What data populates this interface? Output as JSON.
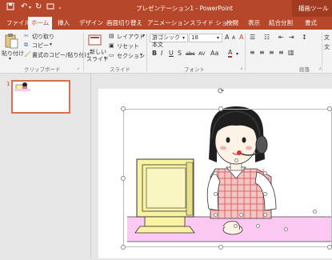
{
  "window": {
    "title": "プレゼンテーション1 - PowerPoint",
    "context_tab_group": "描画ツール"
  },
  "tabs": [
    {
      "label": "ファイル"
    },
    {
      "label": "ホーム"
    },
    {
      "label": "挿入"
    },
    {
      "label": "デザイン"
    },
    {
      "label": "画面切り替え"
    },
    {
      "label": "アニメーション"
    },
    {
      "label": "スライド ショー"
    },
    {
      "label": "校閲"
    },
    {
      "label": "表示"
    },
    {
      "label": "結合分割"
    },
    {
      "label": "書式"
    }
  ],
  "clipboard": {
    "paste": "貼り付け",
    "cut": "切り取り",
    "copy": "コピー",
    "format_painter": "書式のコピー/貼り付け",
    "group_label": "クリップボード"
  },
  "slides": {
    "new_slide": "新しい",
    "new_slide2": "スライド",
    "layout": "レイアウト",
    "reset": "リセット",
    "section": "セクション",
    "group_label": "スライド"
  },
  "font": {
    "name": "游ゴシック 本文",
    "size": "18",
    "bold": "B",
    "italic": "I",
    "underline": "U",
    "strike": "S",
    "shadow": "abc",
    "spacing": "AV",
    "case": "Aa",
    "grow": "A",
    "shrink": "A",
    "clear": "A",
    "color": "A",
    "group_label": "フォント"
  },
  "paragraph": {
    "group_label": "段落",
    "text_dir": "文",
    "text_dir2": "文"
  },
  "slide_panel": {
    "slide_number": "1"
  },
  "colors": {
    "accent": "#b7472a",
    "selection": "#d87050"
  }
}
